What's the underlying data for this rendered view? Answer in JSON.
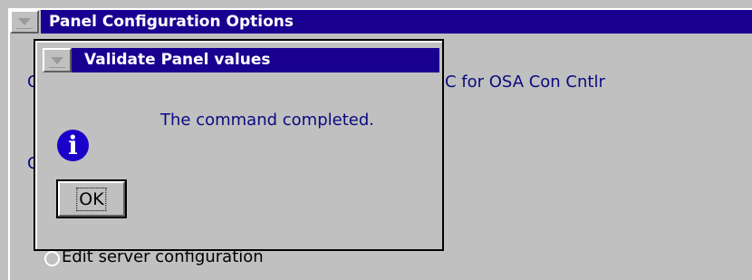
{
  "background_window": {
    "title": "Panel Configuration Options",
    "option_1_partial_text": "C for OSA Con Cntlr",
    "option_hidden_1_initial": "C",
    "option_hidden_2_initial": "C",
    "last_option_label": "Edit server configuration"
  },
  "dialog": {
    "title": "Validate Panel values",
    "message": "The command completed.",
    "icon": "information-icon",
    "ok_label": "OK"
  },
  "colors": {
    "titlebar": "#1a0090",
    "text": "#0a0a80",
    "face": "#c0c0c0"
  }
}
